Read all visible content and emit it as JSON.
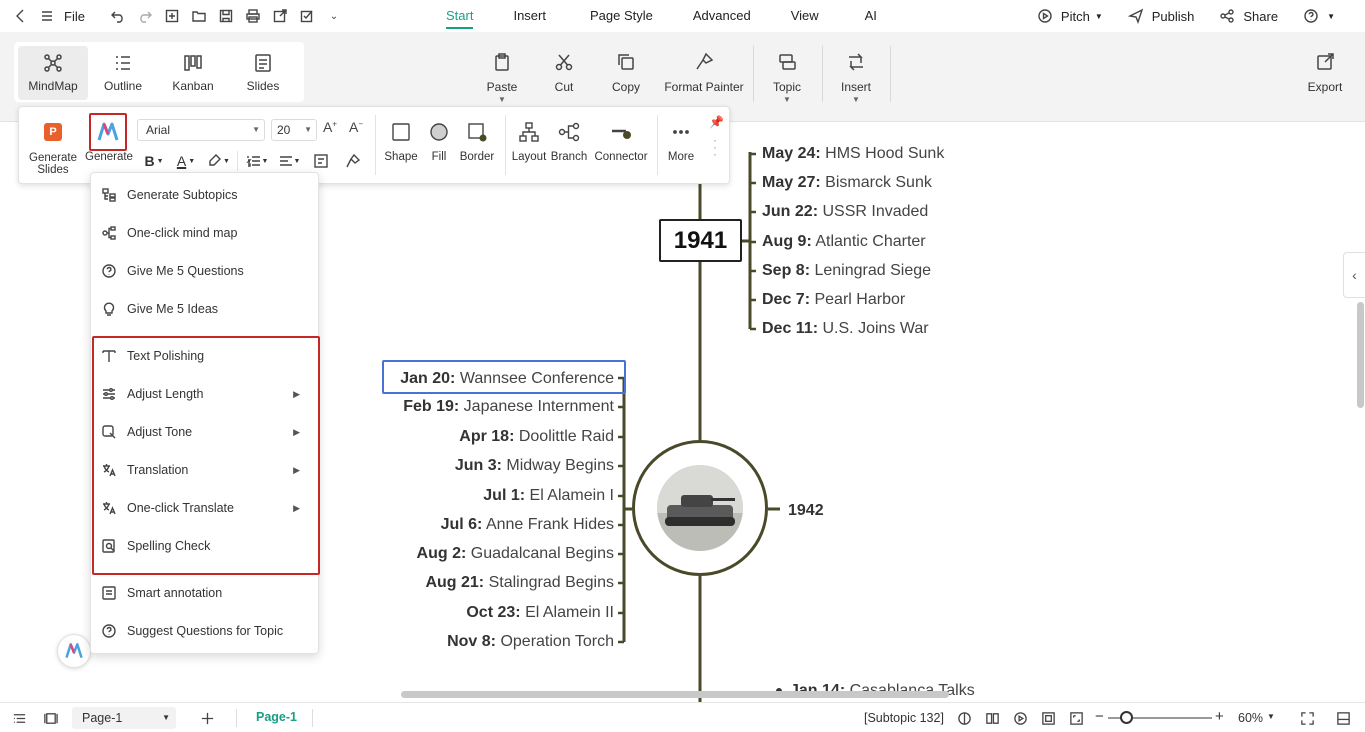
{
  "menubar": {
    "file_label": "File",
    "tabs": [
      {
        "label": "Start",
        "active": true
      },
      {
        "label": "Insert",
        "active": false
      },
      {
        "label": "Page Style",
        "active": false
      },
      {
        "label": "Advanced",
        "active": false
      },
      {
        "label": "View",
        "active": false
      },
      {
        "label": "AI",
        "active": false
      }
    ],
    "pitch_label": "Pitch",
    "publish_label": "Publish",
    "share_label": "Share"
  },
  "views": {
    "mindmap": "MindMap",
    "outline": "Outline",
    "kanban": "Kanban",
    "slides": "Slides"
  },
  "ribbon": {
    "paste": "Paste",
    "cut": "Cut",
    "copy": "Copy",
    "format_painter": "Format Painter",
    "topic": "Topic",
    "insert": "Insert",
    "export": "Export"
  },
  "floatbar": {
    "generate_slides": "Generate Slides",
    "generate": "Generate",
    "font": "Arial",
    "font_size": "20",
    "shape": "Shape",
    "fill": "Fill",
    "border": "Border",
    "layout": "Layout",
    "branch": "Branch",
    "connector": "Connector",
    "more": "More"
  },
  "generate_menu": {
    "items": [
      {
        "label": "Generate Subtopics",
        "icon": "subtopics-icon",
        "submenu": false
      },
      {
        "label": "One-click mind map",
        "icon": "mindmap-icon",
        "submenu": false
      },
      {
        "label": "Give Me 5 Questions",
        "icon": "question-icon",
        "submenu": false
      },
      {
        "label": "Give Me 5 Ideas",
        "icon": "lightbulb-icon",
        "submenu": false
      },
      {
        "label": "Text Polishing",
        "icon": "text-polish-icon",
        "submenu": false
      },
      {
        "label": "Adjust Length",
        "icon": "sliders-icon",
        "submenu": true
      },
      {
        "label": "Adjust Tone",
        "icon": "tone-icon",
        "submenu": true
      },
      {
        "label": "Translation",
        "icon": "translate-icon",
        "submenu": true
      },
      {
        "label": "One-click Translate",
        "icon": "translate-icon",
        "submenu": true
      },
      {
        "label": "Spelling Check",
        "icon": "spell-check-icon",
        "submenu": false
      },
      {
        "label": "Smart annotation",
        "icon": "annotation-icon",
        "submenu": false
      },
      {
        "label": "Suggest Questions for Topic",
        "icon": "question-icon",
        "submenu": false
      }
    ]
  },
  "mindmap": {
    "year_1941": "1941",
    "year_1942": "1942",
    "events_1941": [
      {
        "date": "May 24:",
        "event": "HMS Hood Sunk"
      },
      {
        "date": "May 27:",
        "event": "Bismarck Sunk"
      },
      {
        "date": "Jun 22:",
        "event": "USSR Invaded"
      },
      {
        "date": "Aug 9:",
        "event": "Atlantic Charter"
      },
      {
        "date": "Sep 8:",
        "event": "Leningrad Siege"
      },
      {
        "date": "Dec 7:",
        "event": "Pearl Harbor"
      },
      {
        "date": "Dec 11:",
        "event": "U.S. Joins War"
      }
    ],
    "events_1942": [
      {
        "date": "Jan 20:",
        "event": "Wannsee Conference"
      },
      {
        "date": "Feb 19:",
        "event": "Japanese Internment"
      },
      {
        "date": "Apr 18:",
        "event": "Doolittle Raid"
      },
      {
        "date": "Jun 3:",
        "event": "Midway Begins"
      },
      {
        "date": "Jul 1:",
        "event": "El Alamein I"
      },
      {
        "date": "Jul 6:",
        "event": "Anne Frank Hides"
      },
      {
        "date": "Aug 2:",
        "event": "Guadalcanal Begins"
      },
      {
        "date": "Aug 21:",
        "event": "Stalingrad Begins"
      },
      {
        "date": "Oct 23:",
        "event": "El Alamein II"
      },
      {
        "date": "Nov 8:",
        "event": "Operation Torch"
      }
    ],
    "partial_1943": {
      "date": "Jan 14:",
      "event": "Casablanca Talks"
    }
  },
  "statusbar": {
    "page_select": "Page-1",
    "page_tab": "Page-1",
    "selection_info": "[Subtopic 132]",
    "zoom": "60%"
  },
  "colors": {
    "accent": "#16a085",
    "highlight_red": "#c62828",
    "selection_blue": "#4a72d4",
    "branch_line": "#4a4a2a"
  }
}
